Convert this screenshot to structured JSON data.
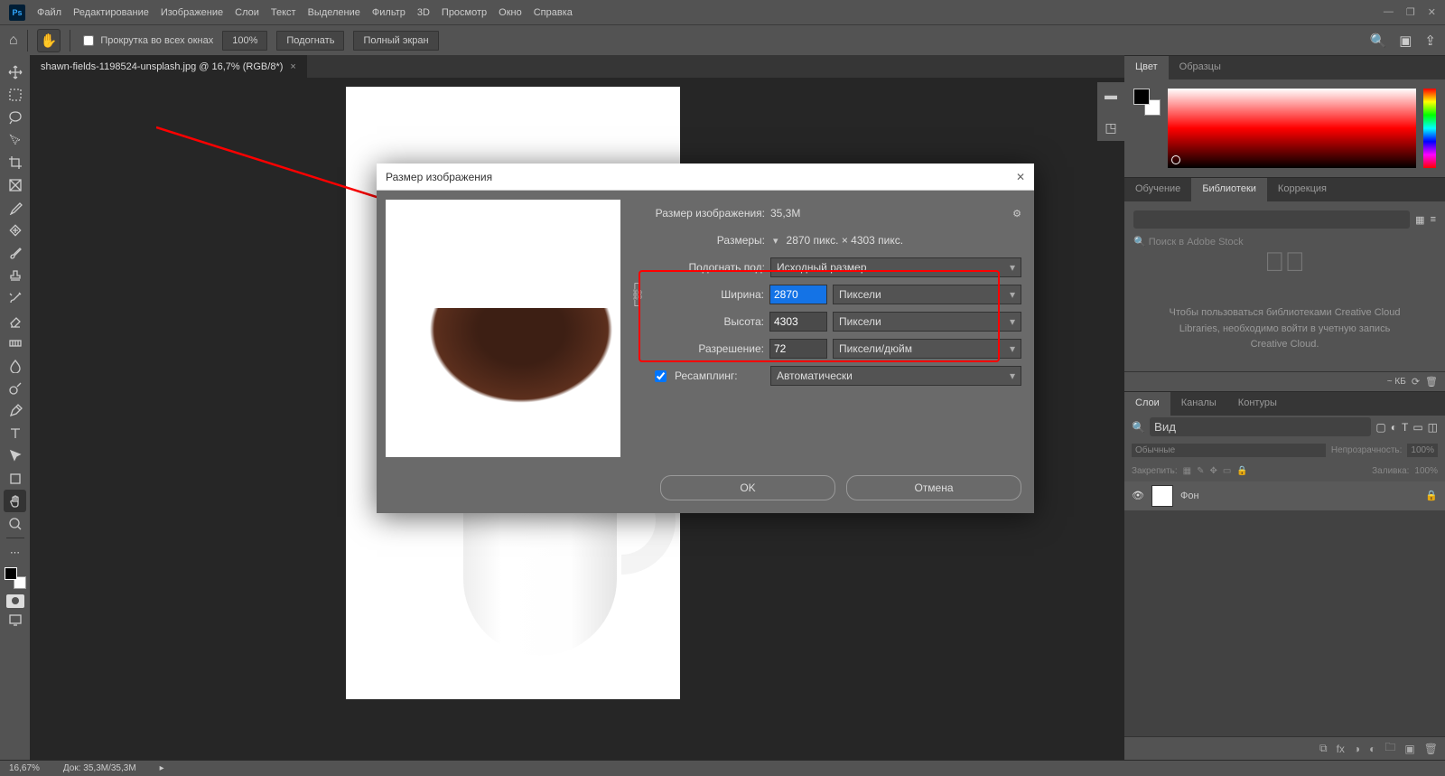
{
  "menubar": {
    "items": [
      "Файл",
      "Редактирование",
      "Изображение",
      "Слои",
      "Текст",
      "Выделение",
      "Фильтр",
      "3D",
      "Просмотр",
      "Окно",
      "Справка"
    ]
  },
  "optionsbar": {
    "scroll_all_windows": "Прокрутка во всех окнах",
    "zoom": "100%",
    "fit": "Подогнать",
    "fullscreen": "Полный экран"
  },
  "doc_tab": {
    "title": "shawn-fields-1198524-unsplash.jpg @ 16,7% (RGB/8*)"
  },
  "panels": {
    "color": {
      "tab1": "Цвет",
      "tab2": "Образцы"
    },
    "lib": {
      "tab1": "Обучение",
      "tab2": "Библиотеки",
      "tab3": "Коррекция",
      "search_placeholder": "Поиск в Adobe Stock",
      "msg": "Чтобы пользоваться библиотеками Creative Cloud Libraries, необходимо войти в учетную запись Creative Cloud.",
      "kb": "~ КБ"
    },
    "layers": {
      "tab1": "Слои",
      "tab2": "Каналы",
      "tab3": "Контуры",
      "search": "Вид",
      "mode": "Обычные",
      "opacity_label": "Непрозрачность:",
      "opacity": "100%",
      "lock_label": "Закрепить:",
      "fill_label": "Заливка:",
      "fill": "100%",
      "layer_name": "Фон"
    }
  },
  "dialog": {
    "title": "Размер изображения",
    "size_label": "Размер изображения:",
    "size_value": "35,3M",
    "dims_label": "Размеры:",
    "dims_value": "2870 пикс. × 4303 пикс.",
    "fitto_label": "Подогнать под:",
    "fitto_value": "Исходный размер",
    "width_label": "Ширина:",
    "width_value": "2870",
    "width_unit": "Пиксели",
    "height_label": "Высота:",
    "height_value": "4303",
    "height_unit": "Пиксели",
    "res_label": "Разрешение:",
    "res_value": "72",
    "res_unit": "Пиксели/дюйм",
    "resample_label": "Ресамплинг:",
    "resample_value": "Автоматически",
    "ok": "OK",
    "cancel": "Отмена"
  },
  "status": {
    "zoom": "16,67%",
    "doc": "Док: 35,3M/35,3M"
  }
}
